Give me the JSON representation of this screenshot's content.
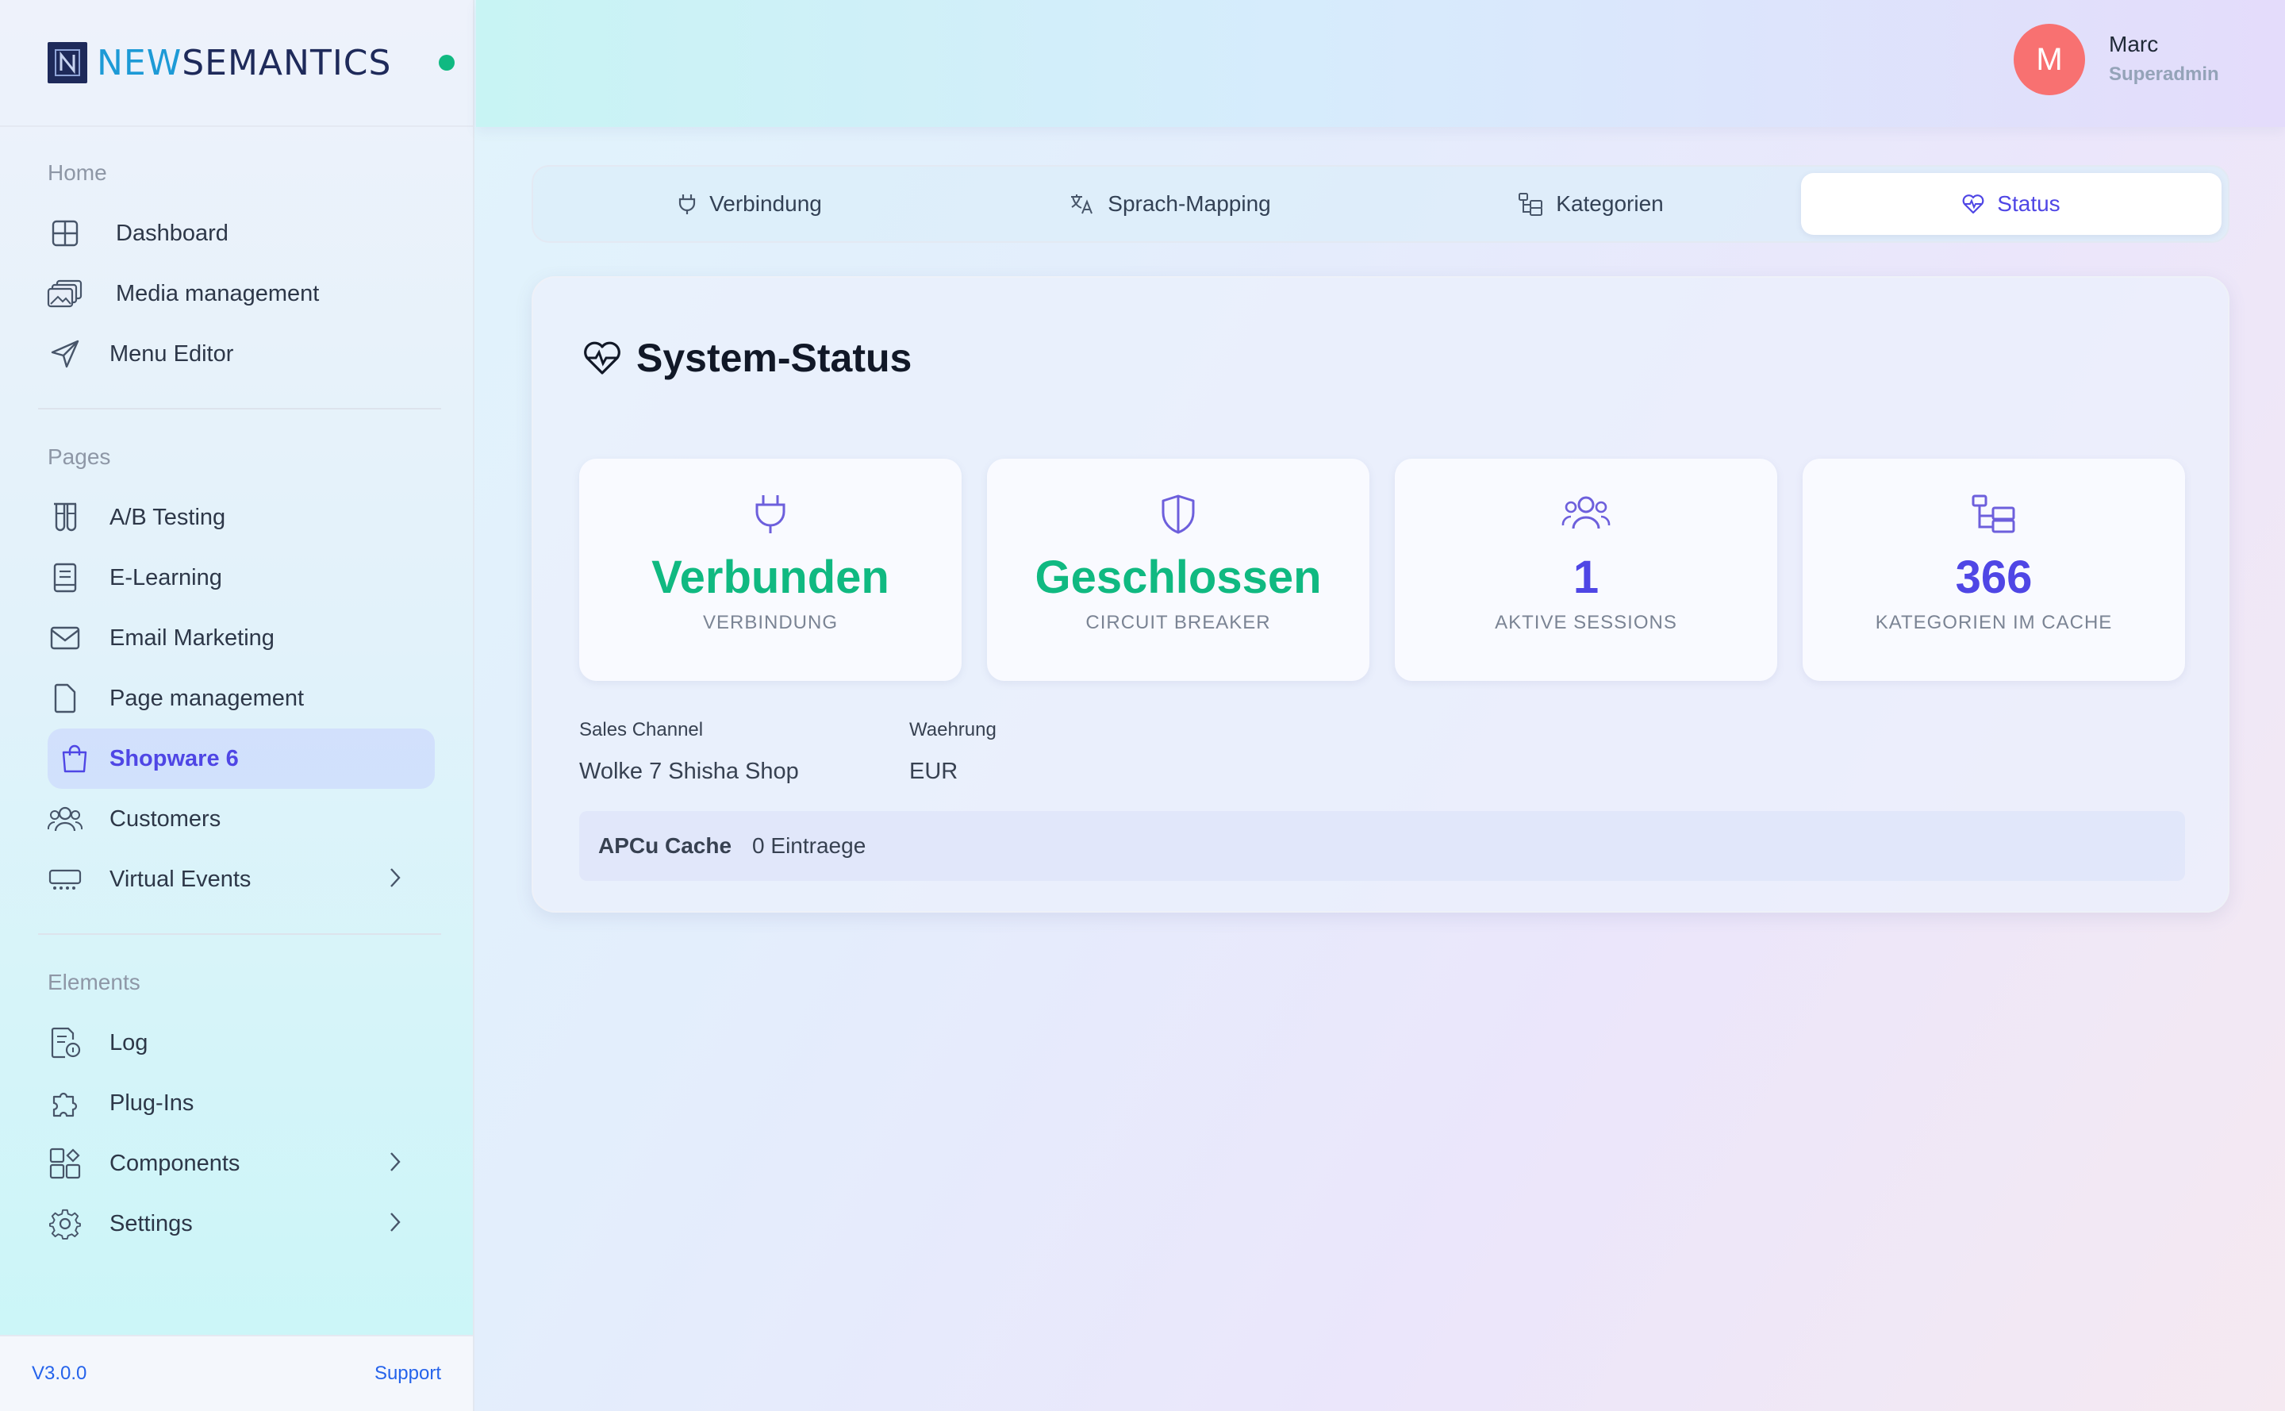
{
  "brand": {
    "part1": "NEW",
    "part2": "SEMANTICS"
  },
  "sidebar": {
    "sections": [
      {
        "title": "Home"
      },
      {
        "title": "Pages"
      },
      {
        "title": "Elements"
      }
    ],
    "home_items": [
      "Dashboard",
      "Media management",
      "Menu Editor"
    ],
    "page_items": [
      "A/B Testing",
      "E-Learning",
      "Email Marketing",
      "Page management",
      "Shopware 6",
      "Customers",
      "Virtual Events"
    ],
    "element_items": [
      "Log",
      "Plug-Ins",
      "Components",
      "Settings"
    ],
    "active_item": "Shopware 6",
    "footer": {
      "version": "V3.0.0",
      "support": "Support"
    }
  },
  "user": {
    "initial": "M",
    "name": "Marc",
    "role": "Superadmin"
  },
  "tabs": [
    {
      "label": "Verbindung",
      "icon": "plug-icon"
    },
    {
      "label": "Sprach-Mapping",
      "icon": "translate-icon"
    },
    {
      "label": "Kategorien",
      "icon": "category-tree-icon"
    },
    {
      "label": "Status",
      "icon": "heart-pulse-icon"
    }
  ],
  "active_tab": "Status",
  "status": {
    "title": "System-Status",
    "stats": [
      {
        "value": "Verbunden",
        "label": "VERBINDUNG",
        "icon": "plug-icon",
        "color": "#10b981"
      },
      {
        "value": "Geschlossen",
        "label": "CIRCUIT BREAKER",
        "icon": "shield-icon",
        "color": "#10b981"
      },
      {
        "value": "1",
        "label": "AKTIVE SESSIONS",
        "icon": "users-icon",
        "color": "#4f46e5"
      },
      {
        "value": "366",
        "label": "KATEGORIEN IM CACHE",
        "icon": "category-tree-icon",
        "color": "#4f46e5"
      }
    ],
    "sales_channel": {
      "label": "Sales Channel",
      "value": "Wolke 7 Shisha Shop"
    },
    "currency": {
      "label": "Waehrung",
      "value": "EUR"
    },
    "cache": {
      "label": "APCu Cache",
      "value": "0 Eintraege"
    }
  },
  "colors": {
    "accent": "#4f46e5",
    "success": "#10b981",
    "avatar": "#f87171",
    "link": "#2563eb"
  }
}
